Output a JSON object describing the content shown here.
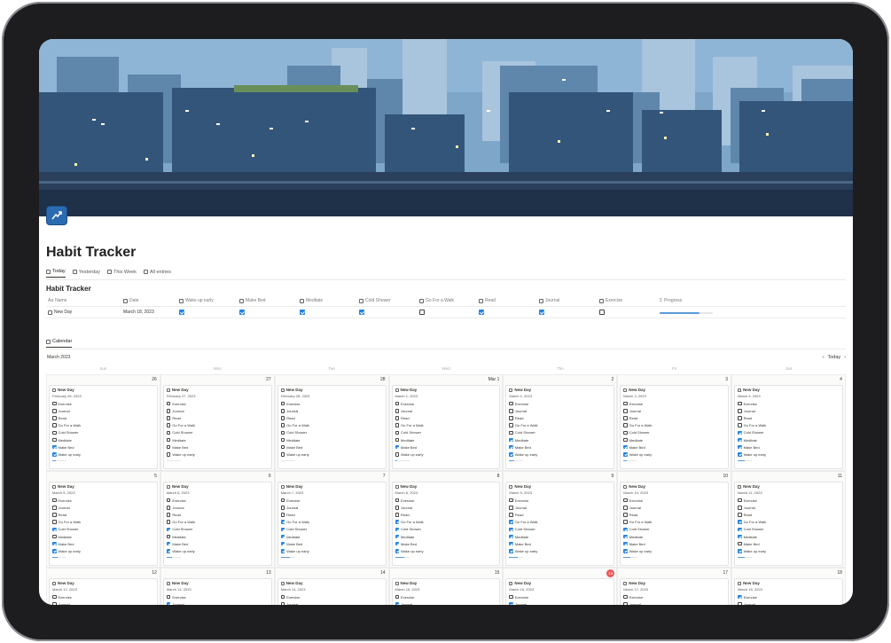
{
  "page": {
    "title": "Habit Tracker",
    "views": [
      {
        "label": "Today",
        "active": true
      },
      {
        "label": "Yesterday",
        "active": false
      },
      {
        "label": "This Week",
        "active": false
      },
      {
        "label": "All entries",
        "active": false
      }
    ]
  },
  "database": {
    "title": "Habit Tracker",
    "columns": [
      "Name",
      "Date",
      "Wake up early",
      "Make Bed",
      "Meditate",
      "Cold Shower",
      "Go For a Walk",
      "Read",
      "Journal",
      "Exercise",
      "Progress"
    ],
    "row": {
      "name": "New Day",
      "date": "March 18, 2023",
      "checks": [
        true,
        true,
        true,
        true,
        false,
        true,
        true,
        false
      ],
      "progress": 0.75
    }
  },
  "calendar": {
    "tab_label": "Calendar",
    "month": "March 2023",
    "today_label": "Today",
    "prev_icon": "chevron-left-icon",
    "next_icon": "chevron-right-icon",
    "weekdays": [
      "Sun",
      "Mon",
      "Tue",
      "Wed",
      "Thu",
      "Fri",
      "Sat"
    ],
    "entry_title": "New Day",
    "habit_labels": [
      "Exercise",
      "Journal",
      "Read",
      "Go For a Walk",
      "Cold Shower",
      "Meditate",
      "Make Bed",
      "Wake up early"
    ],
    "today_number": "16",
    "weeks": [
      [
        {
          "num": "26",
          "date": "February 26, 2023",
          "checks": [
            false,
            false,
            false,
            false,
            false,
            false,
            true,
            true
          ],
          "progress": 0.25
        },
        {
          "num": "27",
          "date": "February 27, 2023",
          "checks": [
            false,
            false,
            false,
            false,
            false,
            false,
            false,
            false
          ],
          "progress": 0.0
        },
        {
          "num": "28",
          "date": "February 28, 2023",
          "checks": [
            false,
            false,
            false,
            false,
            false,
            false,
            false,
            false
          ],
          "progress": 0.0
        },
        {
          "num": "Mar 1",
          "date": "March 1, 2023",
          "checks": [
            false,
            false,
            false,
            false,
            false,
            false,
            true,
            false
          ],
          "progress": 0.125
        },
        {
          "num": "2",
          "date": "March 2, 2023",
          "checks": [
            false,
            false,
            false,
            false,
            false,
            true,
            true,
            true
          ],
          "progress": 0.375
        },
        {
          "num": "3",
          "date": "March 3, 2023",
          "checks": [
            false,
            false,
            false,
            false,
            false,
            false,
            true,
            true
          ],
          "progress": 0.25
        },
        {
          "num": "4",
          "date": "March 4, 2023",
          "checks": [
            false,
            false,
            false,
            false,
            true,
            true,
            true,
            true
          ],
          "progress": 0.5
        }
      ],
      [
        {
          "num": "5",
          "date": "March 5, 2023",
          "checks": [
            false,
            false,
            false,
            false,
            true,
            false,
            true,
            true
          ],
          "progress": 0.375
        },
        {
          "num": "6",
          "date": "March 6, 2023",
          "checks": [
            false,
            false,
            false,
            false,
            true,
            false,
            true,
            true
          ],
          "progress": 0.375
        },
        {
          "num": "7",
          "date": "March 7, 2023",
          "checks": [
            false,
            false,
            false,
            true,
            true,
            true,
            true,
            true
          ],
          "progress": 0.625
        },
        {
          "num": "8",
          "date": "March 8, 2023",
          "checks": [
            false,
            false,
            false,
            true,
            true,
            true,
            true,
            true
          ],
          "progress": 0.625
        },
        {
          "num": "9",
          "date": "March 9, 2023",
          "checks": [
            false,
            false,
            false,
            true,
            true,
            true,
            true,
            true
          ],
          "progress": 0.625
        },
        {
          "num": "10",
          "date": "March 10, 2023",
          "checks": [
            false,
            false,
            false,
            false,
            true,
            true,
            true,
            true
          ],
          "progress": 0.5
        },
        {
          "num": "11",
          "date": "March 11, 2023",
          "checks": [
            false,
            false,
            false,
            true,
            true,
            true,
            false,
            true
          ],
          "progress": 0.5
        }
      ],
      [
        {
          "num": "12",
          "date": "March 12, 2023",
          "checks": [
            false,
            false,
            false,
            false,
            false,
            false,
            false,
            false
          ],
          "progress": 0.0
        },
        {
          "num": "13",
          "date": "March 13, 2023",
          "checks": [
            false,
            true,
            false,
            false,
            false,
            false,
            false,
            false
          ],
          "progress": 0.125
        },
        {
          "num": "14",
          "date": "March 14, 2023",
          "checks": [
            false,
            false,
            false,
            false,
            false,
            false,
            false,
            false
          ],
          "progress": 0.0
        },
        {
          "num": "15",
          "date": "March 15, 2023",
          "checks": [
            false,
            true,
            false,
            false,
            false,
            false,
            false,
            false
          ],
          "progress": 0.125
        },
        {
          "num": "16",
          "date": "March 16, 2023",
          "checks": [
            false,
            true,
            false,
            false,
            false,
            false,
            false,
            false
          ],
          "progress": 0.125
        },
        {
          "num": "17",
          "date": "March 17, 2023",
          "checks": [
            false,
            false,
            false,
            false,
            false,
            false,
            false,
            false
          ],
          "progress": 0.0
        },
        {
          "num": "18",
          "date": "March 18, 2023",
          "checks": [
            true,
            false,
            false,
            false,
            false,
            false,
            false,
            false
          ],
          "progress": 0.125
        }
      ]
    ]
  },
  "colors": {
    "accent": "#2383e2",
    "progress": "#5b9bd5",
    "today_badge": "#eb5757"
  }
}
